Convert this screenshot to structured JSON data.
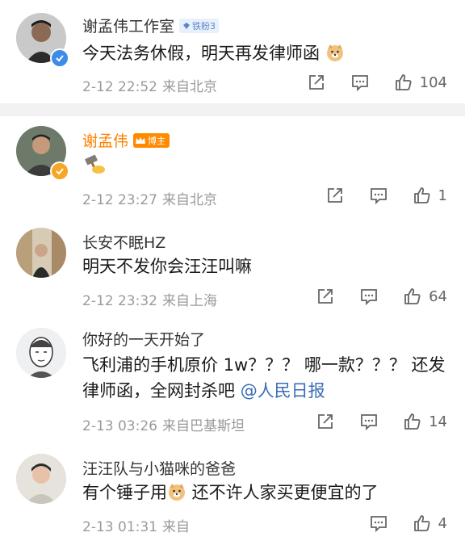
{
  "comments": [
    {
      "name": "谢孟伟工作室",
      "badge": "铁粉3",
      "text": "今天法务休假，明天再发律师函",
      "date": "2-12 22:52",
      "location": "来自北京",
      "likes": "104"
    },
    {
      "name": "谢孟伟",
      "badge": "博主",
      "date": "2-12 23:27",
      "location": "来自北京",
      "likes": "1"
    },
    {
      "name": "长安不眠HZ",
      "text": "明天不发你会汪汪叫嘛",
      "date": "2-12 23:32",
      "location": "来自上海",
      "likes": "64"
    },
    {
      "name": "你好的一天开始了",
      "text_line1": "飞利浦的手机原价 1w？？？ 哪一款？？？ 还发",
      "text_line2": "律师函，全网封杀吧 ",
      "mention": "@人民日报",
      "date": "2-13 03:26",
      "location": "来自巴基斯坦",
      "likes": "14"
    },
    {
      "name": "汪汪队与小猫咪的爸爸",
      "text_part1": "有个锤子用",
      "text_part2": " 还不许人家买更便宜的了",
      "date": "2-13 01:31",
      "location": "来自",
      "likes": "4"
    }
  ],
  "colors": {
    "verified_blue": "#3d8ce8",
    "verified_gold": "#f5a623",
    "name_orange": "#ff8200",
    "mention_blue": "#3b6db5"
  },
  "icons": [
    "share-icon",
    "comment-icon",
    "like-icon",
    "doge-emoji",
    "hammer-emoji"
  ]
}
